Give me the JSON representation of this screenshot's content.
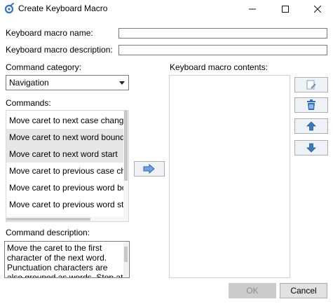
{
  "window": {
    "title": "Create Keyboard Macro",
    "app_icon": "rider-icon",
    "controls": {
      "minimize": "─",
      "maximize": "☐",
      "close": "✕"
    }
  },
  "form": {
    "name_label": "Keyboard macro name:",
    "name_value": "",
    "description_label": "Keyboard macro description:",
    "description_value": "",
    "category_label": "Command category:",
    "category_selected": "Navigation",
    "commands_label": "Commands:",
    "commands": [
      "Move caret to next case change",
      "Move caret to next word boundary",
      "Move caret to next word start",
      "Move caret to previous case change",
      "Move caret to previous word boundary",
      "Move caret to previous word start"
    ],
    "commands_selected": [
      1,
      2
    ],
    "contents_label": "Keyboard macro contents:",
    "contents": [],
    "command_description_label": "Command description:",
    "command_description": "Move the caret to the first character of the next word. Punctuation characters are also grouped as words. Stop at"
  },
  "actions": {
    "add_icon": "arrow-right-icon",
    "edit_icon": "edit-icon",
    "delete_icon": "trash-icon",
    "move_up_icon": "arrow-up-icon",
    "move_down_icon": "arrow-down-icon",
    "ok_label": "OK",
    "cancel_label": "Cancel",
    "ok_enabled": false
  },
  "colors": {
    "accent_blue": "#3a78c3",
    "selection": "#e6e6e6",
    "disabled_button": "#cccccc"
  }
}
